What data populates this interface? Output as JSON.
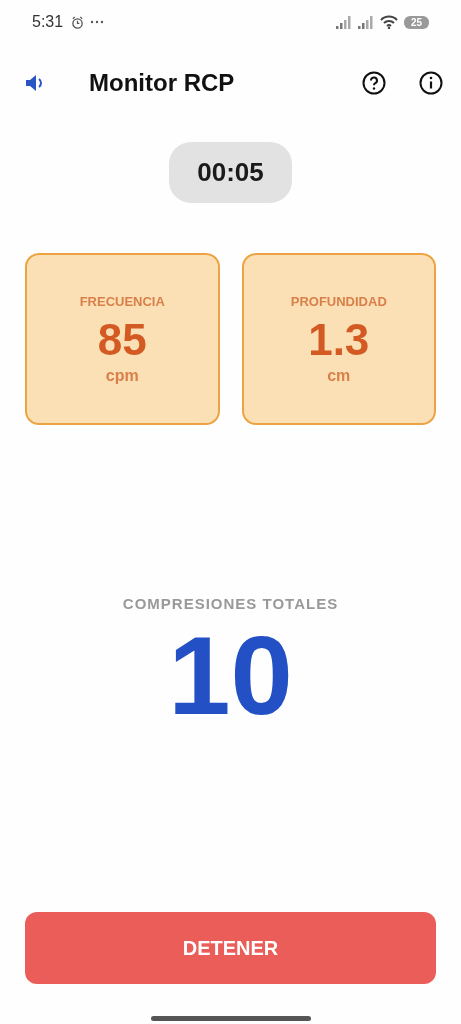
{
  "status_bar": {
    "time": "5:31",
    "battery": "25"
  },
  "header": {
    "title": "Monitor RCP"
  },
  "timer": "00:05",
  "metrics": [
    {
      "label": "FRECUENCIA",
      "value": "85",
      "unit": "cpm"
    },
    {
      "label": "PROFUNDIDAD",
      "value": "1.3",
      "unit": "cm"
    }
  ],
  "total": {
    "label": "COMPRESIONES TOTALES",
    "value": "10"
  },
  "stop_button": "DETENER"
}
